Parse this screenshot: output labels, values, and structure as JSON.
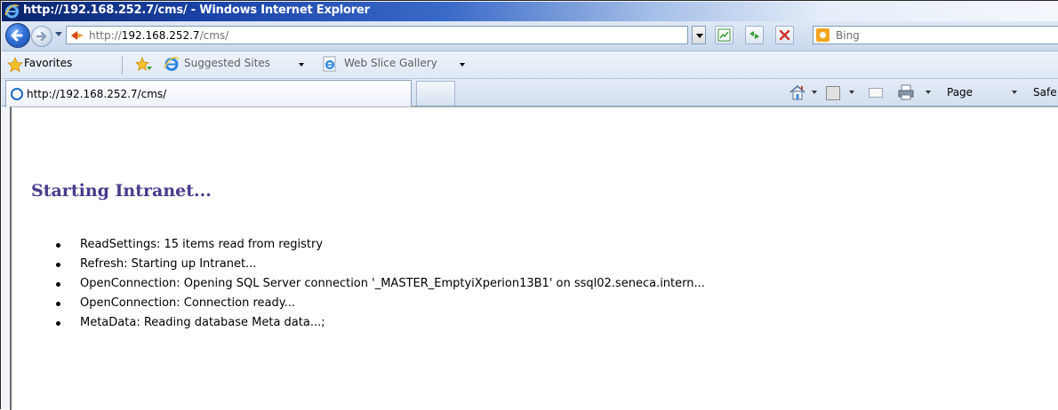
{
  "window": {
    "title": "http://192.168.252.7/cms/ - Windows Internet Explorer"
  },
  "navbar": {
    "address_prefix": "http://",
    "address_host": "192.168.252.7",
    "address_path": "/cms/",
    "search_placeholder": "Bing"
  },
  "favorites_bar": {
    "favorites_label": "Favorites",
    "items": [
      {
        "label": "Suggested Sites",
        "icon": "ie-icon"
      },
      {
        "label": "Web Slice Gallery",
        "icon": "ie-icon"
      }
    ]
  },
  "tab": {
    "label": "http://192.168.252.7/cms/"
  },
  "command_bar": {
    "page_label": "Page",
    "safety_label": "Safe"
  },
  "page": {
    "heading": "Starting Intranet...",
    "log": [
      "ReadSettings: 15 items read from registry",
      "Refresh: Starting up Intranet...",
      "OpenConnection: Opening SQL Server connection '_MASTER_EmptyiXperion13B1' on ssql02.seneca.intern...",
      "OpenConnection: Connection ready...",
      "MetaData: Reading database Meta data...;"
    ]
  },
  "colors": {
    "heading": "#4b3a8c",
    "titlebar": "#0a246a"
  }
}
